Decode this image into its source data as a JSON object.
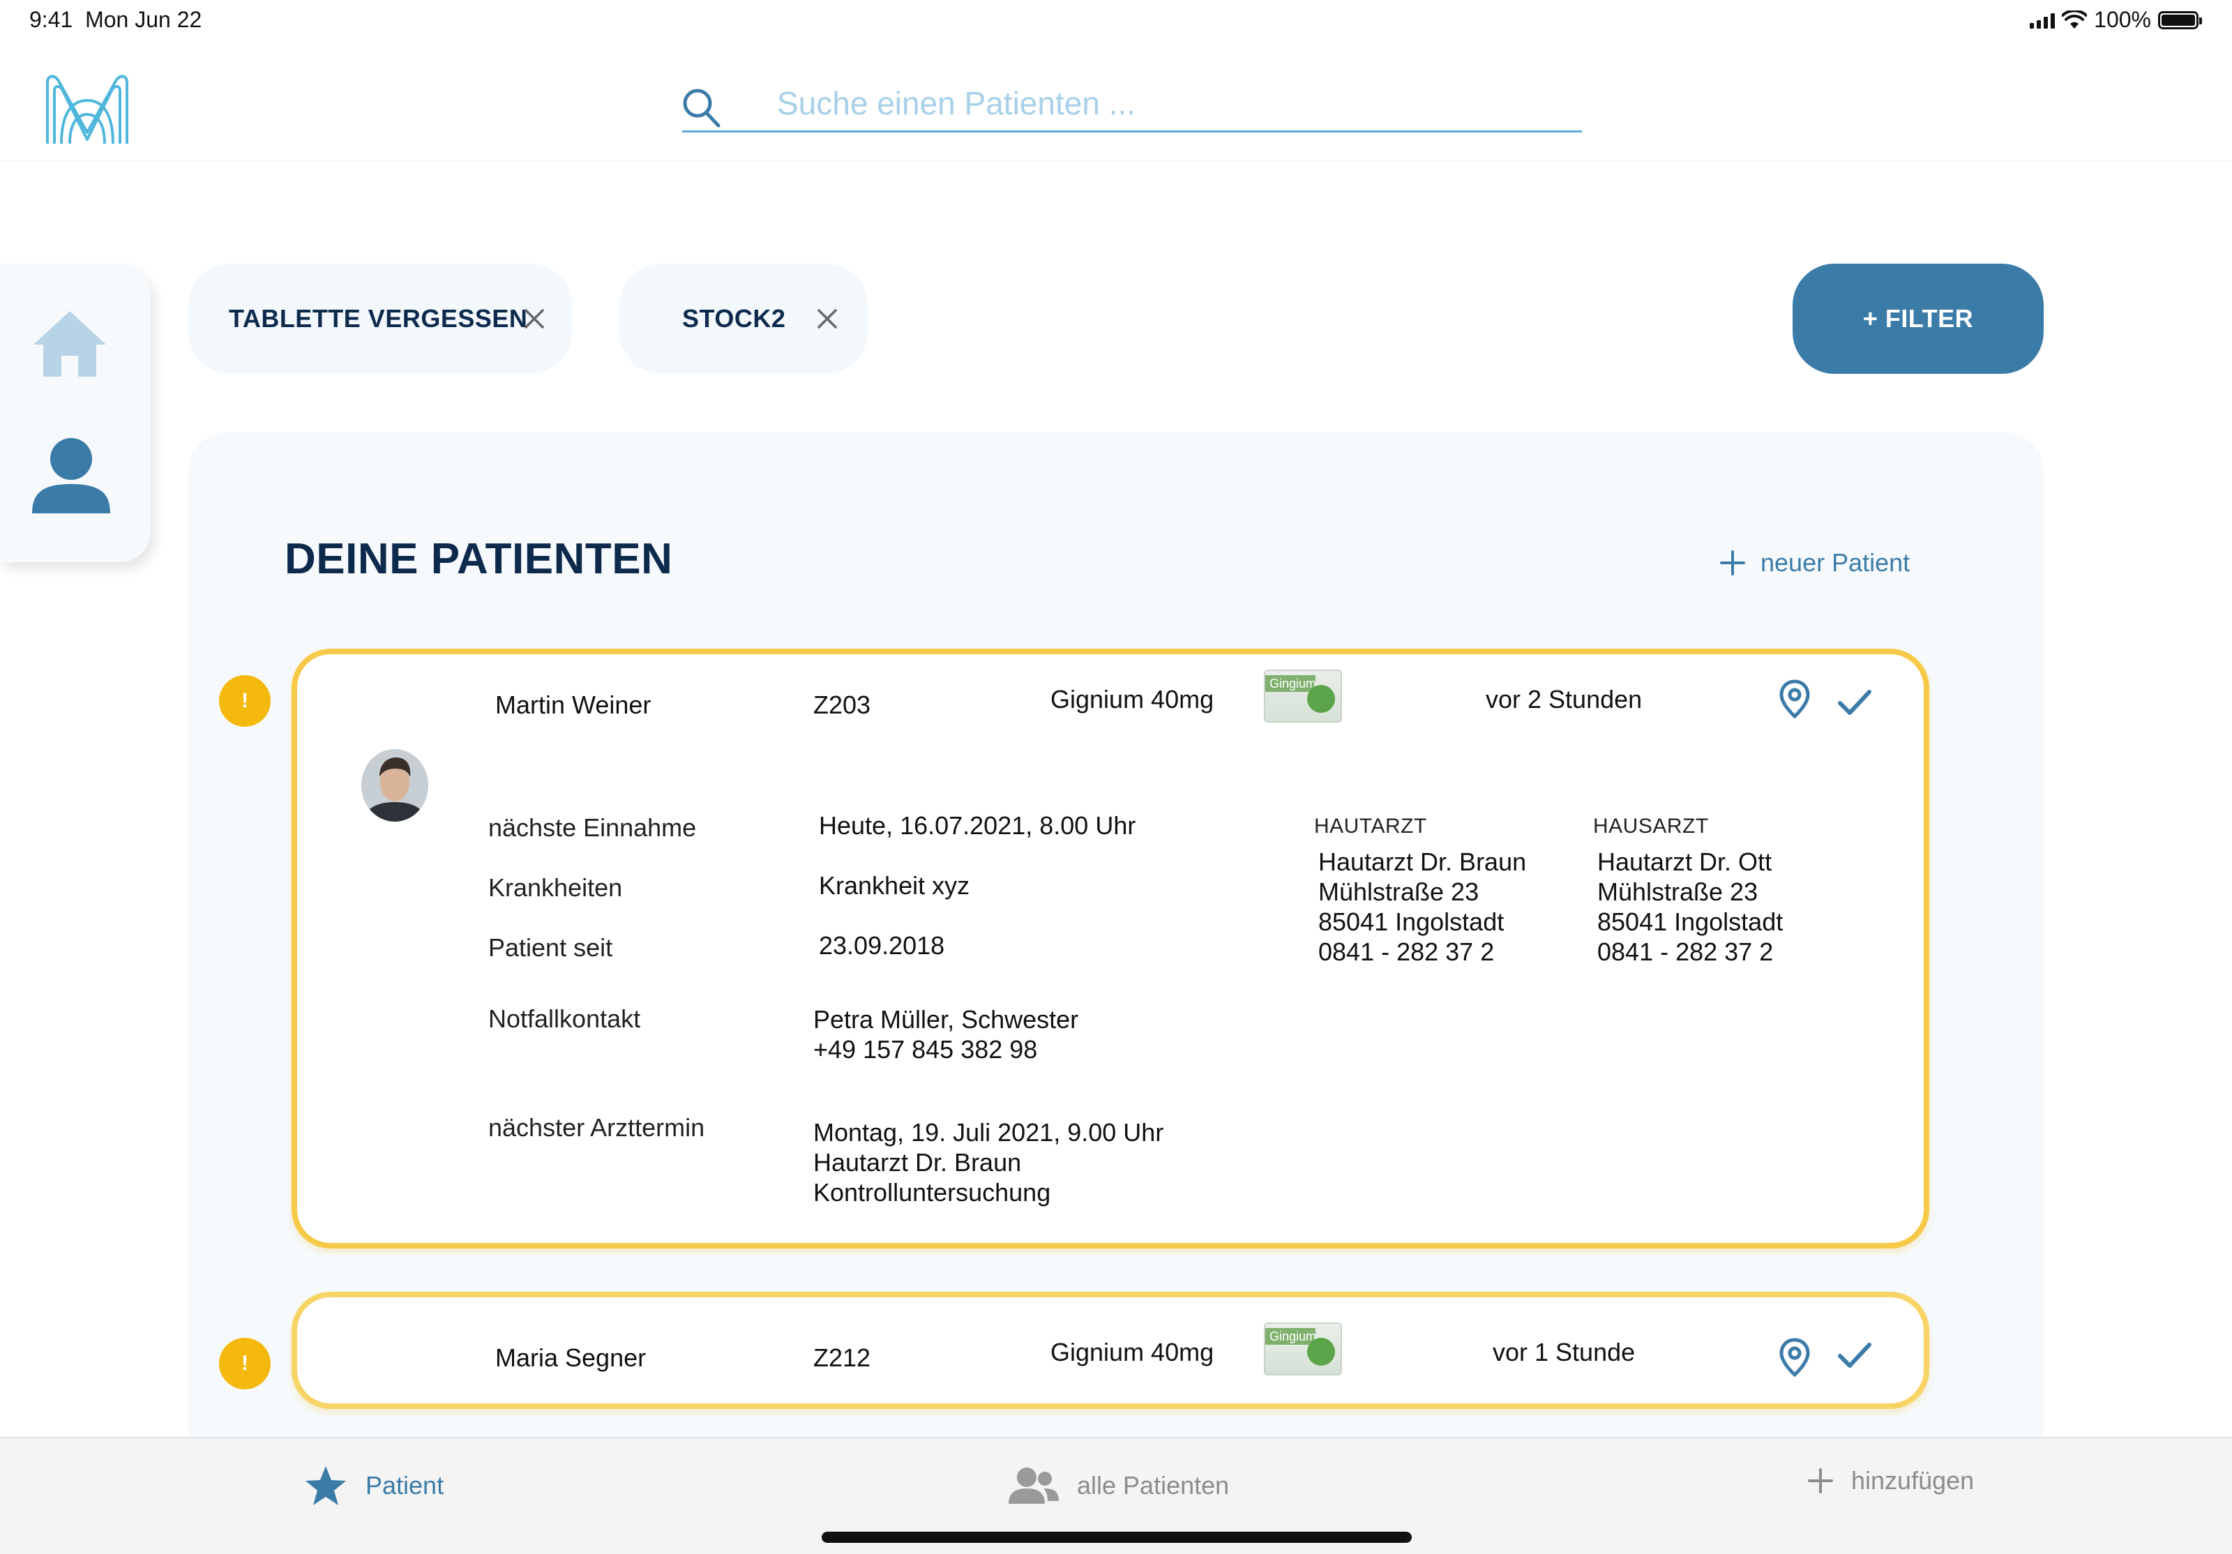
{
  "status_bar": {
    "time": "9:41",
    "date": "Mon Jun 22",
    "battery_text": "100%",
    "battery_level": 1.0
  },
  "header": {
    "logo_icon": "medical-m-logo-icon",
    "search": {
      "placeholder": "Suche einen Patienten ...",
      "value": "",
      "icon": "search-icon"
    }
  },
  "sidenav": {
    "items": [
      {
        "icon": "home-icon",
        "active": false
      },
      {
        "icon": "user-icon",
        "active": true
      }
    ]
  },
  "filters": {
    "chips": [
      {
        "label": "TABLETTE VERGESSEN"
      },
      {
        "label": "STOCK2"
      }
    ],
    "add_label": "+ FILTER"
  },
  "panel": {
    "title": "DEINE PATIENTEN",
    "new_patient_label": "neuer Patient",
    "patients": [
      {
        "name": "Martin Weiner",
        "room": "Z203",
        "medication": "Gignium 40mg",
        "time": "vor 2 Stunden",
        "details": {
          "next_intake_label": "nächste Einnahme",
          "next_intake_value": "Heute, 16.07.2021, 8.00 Uhr",
          "diseases_label": "Krankheiten",
          "diseases_value": "Krankheit xyz",
          "patient_since_label": "Patient seit",
          "patient_since_value": "23.09.2018",
          "emergency_label": "Notfallkontakt",
          "emergency_name": "Petra Müller, Schwester",
          "emergency_phone": "+49 157 845 382 98",
          "appointment_label": "nächster Arzttermin",
          "appointment_date": "Montag, 19. Juli 2021, 9.00 Uhr",
          "appointment_doctor": "Hautarzt Dr. Braun",
          "appointment_type": "Kontrolluntersuchung"
        },
        "doctors": [
          {
            "heading": "HAUTARZT",
            "name": "Hautarzt Dr. Braun",
            "street": "Mühlstraße 23",
            "city": "85041 Ingolstadt",
            "phone": "0841 - 282 37 2"
          },
          {
            "heading": "HAUSARZT",
            "name": "Hautarzt Dr. Ott",
            "street": "Mühlstraße 23",
            "city": "85041 Ingolstadt",
            "phone": "0841 - 282 37 2"
          }
        ]
      },
      {
        "name": "Maria Segner",
        "room": "Z212",
        "medication": "Gignium 40mg",
        "time": "vor 1 Stunde"
      }
    ],
    "warning_mark": "!",
    "medication_package_text": "Gingium"
  },
  "tabbar": {
    "tabs": [
      {
        "label": "Patient",
        "icon": "star-icon",
        "active": true
      },
      {
        "label": "alle Patienten",
        "icon": "users-icon",
        "active": false
      },
      {
        "label": "hinzufügen",
        "icon": "plus-icon",
        "active": false
      }
    ]
  },
  "colors": {
    "accent": "#3b7ba8",
    "navy": "#0d2a4d",
    "warning": "#f5b80c",
    "card_border": "#f7c948",
    "panel_bg": "#f6fafd"
  }
}
